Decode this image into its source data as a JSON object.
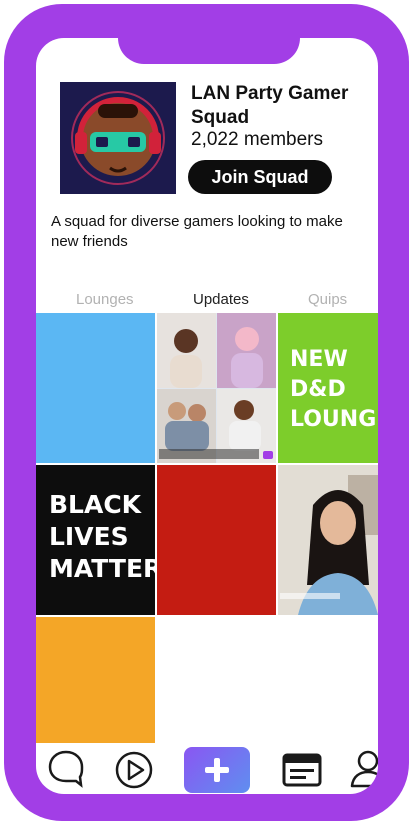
{
  "squad": {
    "name": "LAN Party Gamer Squad",
    "members": "2,022 members",
    "join_label": "Join Squad",
    "description": "A squad for diverse gamers looking to make new friends"
  },
  "tabs": [
    {
      "label": "Lounges",
      "active": false
    },
    {
      "label": "Updates",
      "active": true
    },
    {
      "label": "Quips",
      "active": false
    }
  ],
  "tiles": {
    "dnd": [
      "NEW",
      "D&D",
      "LOUNGE!"
    ],
    "blm": [
      "BLACK",
      "LIVES",
      "MATTER"
    ]
  },
  "nav": [
    "chat-icon",
    "play-icon",
    "plus-icon",
    "feed-icon",
    "profile-icon"
  ],
  "colors": {
    "frame": "#a23ee6",
    "blue_tile": "#5bb7f3",
    "green_tile": "#7dcd2b",
    "black_tile": "#0d0d0d",
    "red_tile": "#c41c12",
    "orange_tile": "#f4a627"
  }
}
